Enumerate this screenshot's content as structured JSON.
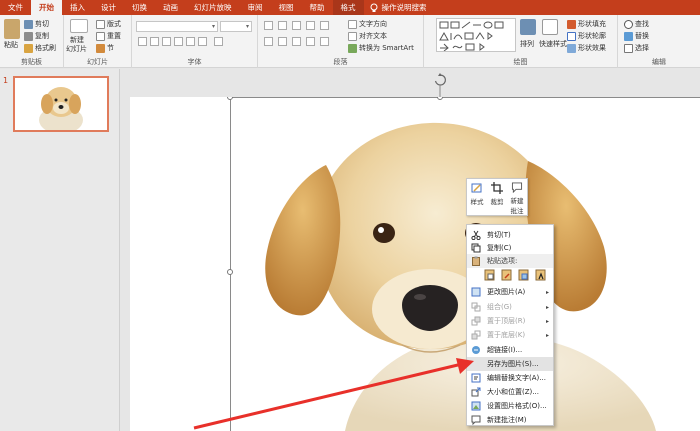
{
  "tabs": [
    "文件",
    "开始",
    "插入",
    "设计",
    "切换",
    "动画",
    "幻灯片放映",
    "审阅",
    "视图",
    "帮助",
    "格式"
  ],
  "active_tab": "开始",
  "search_label": "操作说明搜索",
  "ribbon": {
    "clipboard": {
      "paste": "粘贴",
      "cut": "剪切",
      "copy": "复制",
      "format_painter": "格式刷",
      "label": "剪贴板"
    },
    "slides": {
      "new_slide_line1": "新建",
      "new_slide_line2": "幻灯片",
      "layout": "版式",
      "reset": "重置",
      "section": "节",
      "label": "幻灯片"
    },
    "font": {
      "label": "字体"
    },
    "paragraph": {
      "text_direction": "文字方向",
      "align_text": "对齐文本",
      "smartart": "转换为 SmartArt",
      "label": "段落"
    },
    "drawing": {
      "arrange": "排列",
      "quick_styles": "快速样式",
      "shape_fill": "形状填充",
      "shape_outline": "形状轮廓",
      "shape_effects": "形状效果",
      "label": "绘图"
    },
    "editing": {
      "find": "查找",
      "replace": "替换",
      "select": "选择",
      "label": "编辑"
    }
  },
  "thumbnail": {
    "slide_number": "1"
  },
  "mini_toolbar": {
    "style": "样式",
    "crop": "裁剪",
    "new_comment_line1": "新建",
    "new_comment_line2": "批注"
  },
  "context_menu": {
    "cut": "剪切(T)",
    "copy": "复制(C)",
    "paste_options": "粘贴选项:",
    "change_picture": "更改图片(A)",
    "group": "组合(G)",
    "bring_to_front": "置于顶层(R)",
    "send_to_back": "置于底层(K)",
    "link": "超链接(I)...",
    "save_as_picture": "另存为图片(S)...",
    "edit_alt_text": "编辑替换文字(A)...",
    "size_position": "大小和位置(Z)...",
    "format_picture": "设置图片格式(O)...",
    "new_comment": "新建批注(M)"
  },
  "colors": {
    "accent": "#c43e1c",
    "arrow": "#e8302a"
  }
}
